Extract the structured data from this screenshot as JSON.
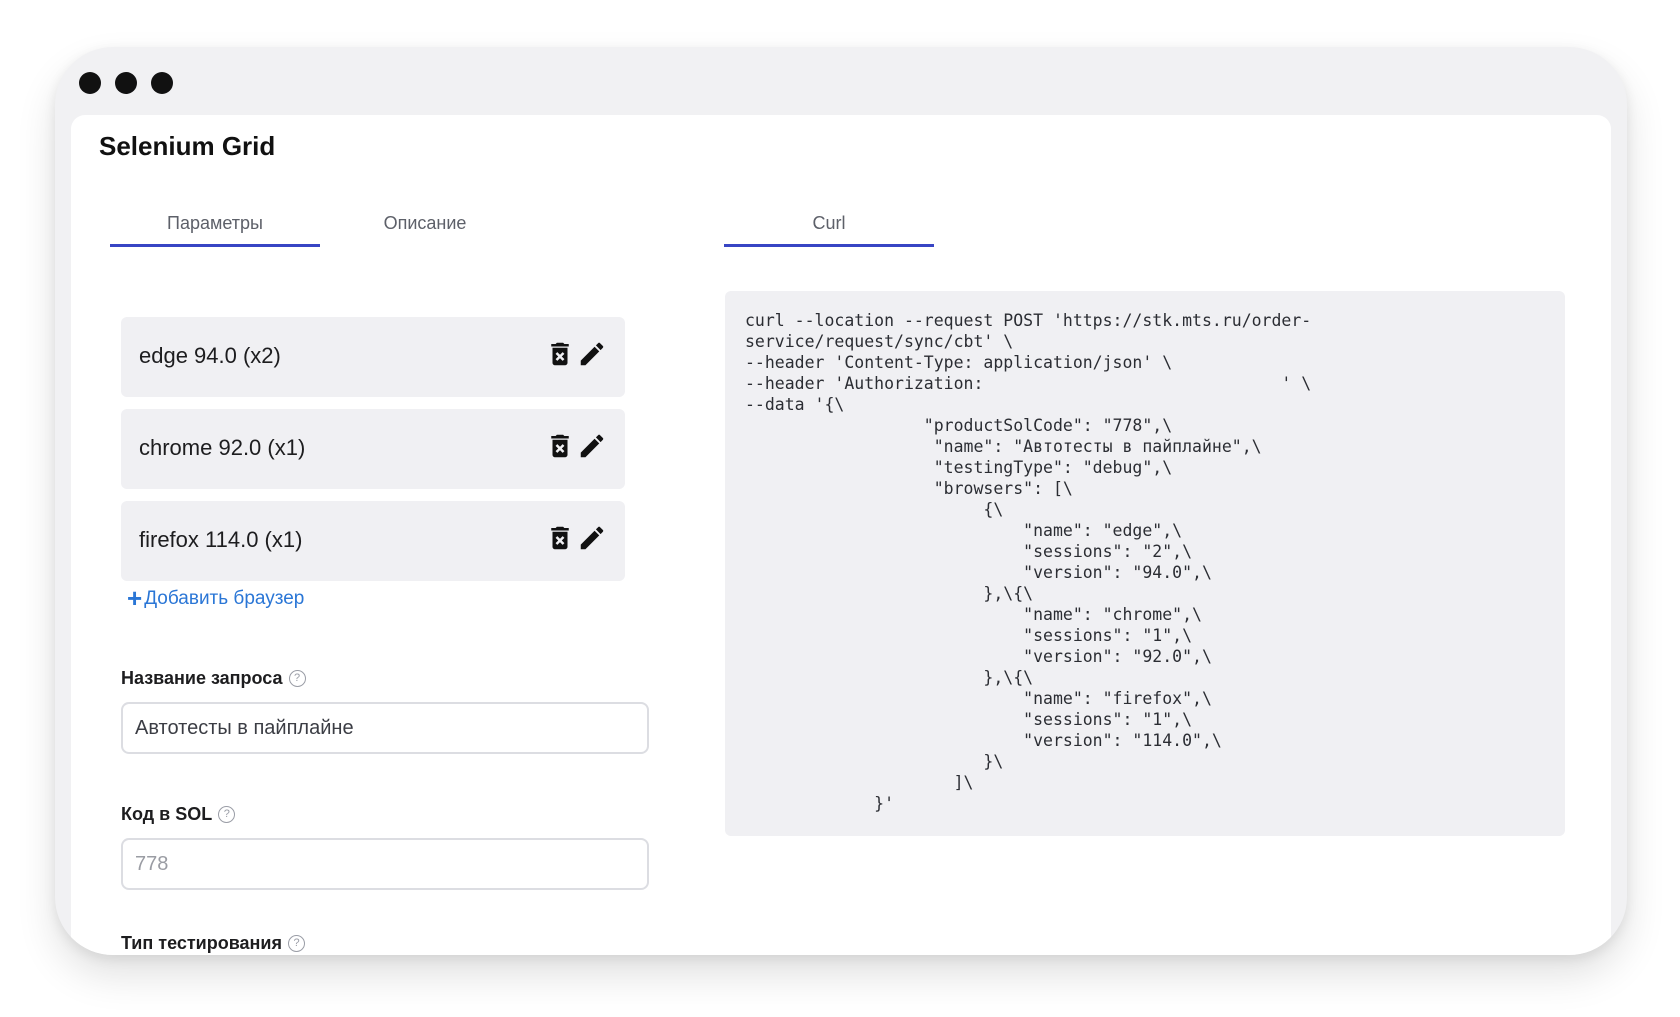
{
  "app": {
    "title": "Selenium Grid"
  },
  "tabs": {
    "left": [
      {
        "label": "Параметры",
        "active": true
      },
      {
        "label": "Описание",
        "active": false
      }
    ],
    "right": [
      {
        "label": "Curl",
        "active": true
      }
    ]
  },
  "browsers": [
    {
      "label": "edge 94.0 (x2)"
    },
    {
      "label": "chrome 92.0 (x1)"
    },
    {
      "label": "firefox 114.0 (x1)"
    }
  ],
  "add_browser": {
    "label": "Добавить браузер",
    "icon": "plus-icon"
  },
  "fields": {
    "request_name": {
      "label": "Название запроса",
      "value": "Автотесты в пайплайне"
    },
    "sol_code": {
      "label": "Код в SOL",
      "placeholder": "778"
    },
    "testing_type": {
      "label": "Тип тестирования"
    }
  },
  "curl": {
    "text": "curl --location --request POST 'https://stk.mts.ru/order-\nservice/request/sync/cbt' \\\n--header 'Content-Type: application/json' \\\n--header 'Authorization:                              ' \\\n--data '{\\\n                  \"productSolCode\": \"778\",\\\n                   \"name\": \"Автотесты в пайплайне\",\\\n                   \"testingType\": \"debug\",\\\n                   \"browsers\": [\\\n                        {\\\n                            \"name\": \"edge\",\\\n                            \"sessions\": \"2\",\\\n                            \"version\": \"94.0\",\\\n                        },\\{\\\n                            \"name\": \"chrome\",\\\n                            \"sessions\": \"1\",\\\n                            \"version\": \"92.0\",\\\n                        },\\{\\\n                            \"name\": \"firefox\",\\\n                            \"sessions\": \"1\",\\\n                            \"version\": \"114.0\",\\\n                        }\\\n                     ]\\\n             }'"
  },
  "colors": {
    "accent": "#3845c4",
    "link": "#2a76d6",
    "item_bg": "#f0f0f3"
  }
}
